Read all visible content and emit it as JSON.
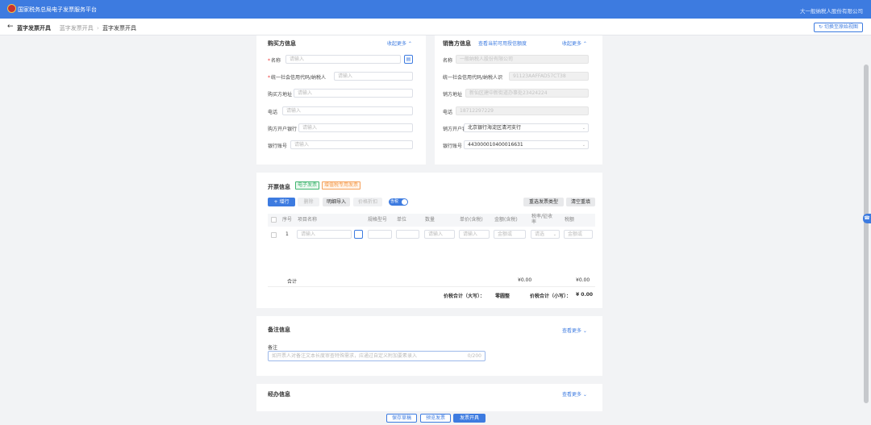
{
  "header": {
    "app_title": "国家税务总局电子发票服务平台",
    "company": "大一般纳税人股份有限公司"
  },
  "breadcrumb": {
    "back": "←",
    "title": "蓝字发票开具",
    "items": [
      "蓝字发票开具",
      "蓝字发票开具"
    ],
    "switch_label": "切换至原始视图"
  },
  "buyer": {
    "title": "购买方信息",
    "collapse": "收起更多",
    "fields": [
      {
        "label": "名称",
        "required": true,
        "placeholder": "请输入"
      },
      {
        "label": "统一社会信用代码/纳税人",
        "required": true,
        "placeholder": "请输入"
      },
      {
        "label": "购买方地址",
        "placeholder": "请输入"
      },
      {
        "label": "电话",
        "placeholder": "请输入"
      },
      {
        "label": "购方开户银行",
        "placeholder": "请输入"
      },
      {
        "label": "银行账号",
        "placeholder": "请输入"
      }
    ]
  },
  "seller": {
    "title": "销售方信息",
    "link": "查看当前可用授信额度",
    "collapse": "收起更多",
    "fields": [
      {
        "label": "名称",
        "value": "一般纳税人股份有限公司"
      },
      {
        "label": "统一社会信用代码/纳税人识",
        "value": "91123AAFFAD57CT38"
      },
      {
        "label": "销方地址",
        "value": "新仙区建中新街道办事处23424224"
      },
      {
        "label": "电话",
        "value": "18712297229"
      },
      {
        "label": "销方开户银行",
        "value": "北京银行海淀区清河支行"
      },
      {
        "label": "银行账号",
        "value": "443000010400016631"
      }
    ]
  },
  "invoice": {
    "title": "开票信息",
    "tag_green": "电子发票",
    "tag_orange": "增值税专用发票",
    "btns": {
      "add_row": "+ 增行",
      "delete": "删除",
      "import": "明细导入",
      "price_tax": "价格折扣",
      "tax_toggle": "含税",
      "reselect": "重选发票类型",
      "clear": "清空重填"
    },
    "columns": [
      "序号",
      "项目名称",
      "规格型号",
      "单位",
      "数量",
      "单价(含税)",
      "金额(含税)",
      "税率/征收率",
      "税额"
    ],
    "row": {
      "index": "1",
      "name": "请输入",
      "qty": "请输入",
      "price": "请输入",
      "amount": "金额或",
      "rate": "请选",
      "tax": "金额或"
    },
    "total_label": "合计",
    "total_amount": "¥0.00",
    "total_tax": "¥0.00",
    "sum_upper_label": "价税合计（大写）：",
    "sum_upper": "零圆整",
    "sum_lower_label": "价税合计（小写）：",
    "sum_lower": "¥ 0.00"
  },
  "remark": {
    "title": "备注信息",
    "more": "查看更多",
    "label": "备注",
    "placeholder": "如开票人对备注文本长度审查特殊需求，应通过自定义附加要素录入",
    "count": "0/200"
  },
  "handler": {
    "title": "经办信息",
    "more": "查看更多"
  },
  "footer": {
    "save": "保存草稿",
    "preview": "预览发票",
    "issue": "发票开具"
  }
}
